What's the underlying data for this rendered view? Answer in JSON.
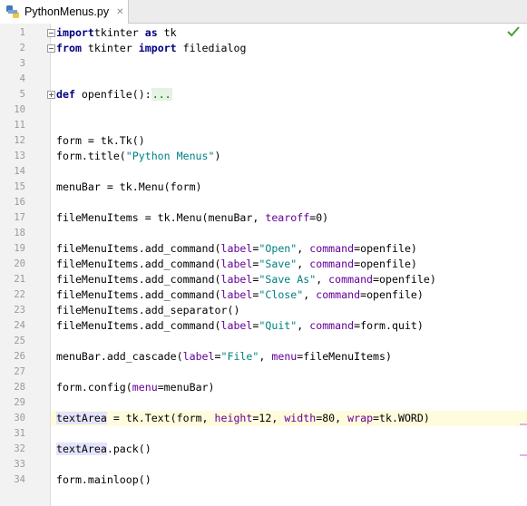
{
  "tab": {
    "title": "PythonMenus.py",
    "close": "✕"
  },
  "colors": {
    "keyword": "#000080",
    "string": "#008080",
    "kwarg": "#660099",
    "current_line": "#fffbdd"
  },
  "current_line": 30,
  "lines": [
    {
      "n": "1",
      "tokens": [
        [
          "kw",
          "import"
        ],
        [
          "",
          "tkinter "
        ],
        [
          "kw",
          "as"
        ],
        [
          "",
          " tk"
        ]
      ]
    },
    {
      "n": "2",
      "tokens": [
        [
          "kw",
          "from"
        ],
        [
          "",
          " tkinter "
        ],
        [
          "kw",
          "import"
        ],
        [
          "",
          " filedialog"
        ]
      ]
    },
    {
      "n": "3",
      "tokens": []
    },
    {
      "n": "4",
      "tokens": []
    },
    {
      "n": "5",
      "tokens": [
        [
          "kw",
          "def"
        ],
        [
          "",
          " openfile():"
        ],
        [
          "collapsed",
          "..."
        ]
      ]
    },
    {
      "n": "10",
      "tokens": []
    },
    {
      "n": "11",
      "tokens": []
    },
    {
      "n": "12",
      "tokens": [
        [
          "",
          "form = tk.Tk()"
        ]
      ]
    },
    {
      "n": "13",
      "tokens": [
        [
          "",
          "form.title("
        ],
        [
          "str",
          "\"Python Menus\""
        ],
        [
          "",
          ")"
        ]
      ]
    },
    {
      "n": "14",
      "tokens": []
    },
    {
      "n": "15",
      "tokens": [
        [
          "",
          "menuBar = tk.Menu(form)"
        ]
      ]
    },
    {
      "n": "16",
      "tokens": []
    },
    {
      "n": "17",
      "tokens": [
        [
          "",
          "fileMenuItems = tk.Menu(menuBar, "
        ],
        [
          "kwarg",
          "tearoff"
        ],
        [
          "",
          "=0)"
        ]
      ]
    },
    {
      "n": "18",
      "tokens": []
    },
    {
      "n": "19",
      "tokens": [
        [
          "",
          "fileMenuItems.add_command("
        ],
        [
          "kwarg",
          "label"
        ],
        [
          "",
          "="
        ],
        [
          "str",
          "\"Open\""
        ],
        [
          "",
          ", "
        ],
        [
          "kwarg",
          "command"
        ],
        [
          "",
          "=openfile)"
        ]
      ]
    },
    {
      "n": "20",
      "tokens": [
        [
          "",
          "fileMenuItems.add_command("
        ],
        [
          "kwarg",
          "label"
        ],
        [
          "",
          "="
        ],
        [
          "str",
          "\"Save\""
        ],
        [
          "",
          ", "
        ],
        [
          "kwarg",
          "command"
        ],
        [
          "",
          "=openfile)"
        ]
      ]
    },
    {
      "n": "21",
      "tokens": [
        [
          "",
          "fileMenuItems.add_command("
        ],
        [
          "kwarg",
          "label"
        ],
        [
          "",
          "="
        ],
        [
          "str",
          "\"Save As\""
        ],
        [
          "",
          ", "
        ],
        [
          "kwarg",
          "command"
        ],
        [
          "",
          "=openfile)"
        ]
      ]
    },
    {
      "n": "22",
      "tokens": [
        [
          "",
          "fileMenuItems.add_command("
        ],
        [
          "kwarg",
          "label"
        ],
        [
          "",
          "="
        ],
        [
          "str",
          "\"Close\""
        ],
        [
          "",
          ", "
        ],
        [
          "kwarg",
          "command"
        ],
        [
          "",
          "=openfile)"
        ]
      ]
    },
    {
      "n": "23",
      "tokens": [
        [
          "",
          "fileMenuItems.add_separator()"
        ]
      ]
    },
    {
      "n": "24",
      "tokens": [
        [
          "",
          "fileMenuItems.add_command("
        ],
        [
          "kwarg",
          "label"
        ],
        [
          "",
          "="
        ],
        [
          "str",
          "\"Quit\""
        ],
        [
          "",
          ", "
        ],
        [
          "kwarg",
          "command"
        ],
        [
          "",
          "=form.quit)"
        ]
      ]
    },
    {
      "n": "25",
      "tokens": []
    },
    {
      "n": "26",
      "tokens": [
        [
          "",
          "menuBar.add_cascade("
        ],
        [
          "kwarg",
          "label"
        ],
        [
          "",
          "="
        ],
        [
          "str",
          "\"File\""
        ],
        [
          "",
          ", "
        ],
        [
          "kwarg",
          "menu"
        ],
        [
          "",
          "=fileMenuItems)"
        ]
      ]
    },
    {
      "n": "27",
      "tokens": []
    },
    {
      "n": "28",
      "tokens": [
        [
          "",
          "form.config("
        ],
        [
          "kwarg",
          "menu"
        ],
        [
          "",
          "=menuBar)"
        ]
      ]
    },
    {
      "n": "29",
      "tokens": []
    },
    {
      "n": "30",
      "tokens": [
        [
          "ref-hl",
          "textArea"
        ],
        [
          "",
          " = tk.Text(form, "
        ],
        [
          "kwarg",
          "height"
        ],
        [
          "",
          "=12, "
        ],
        [
          "kwarg",
          "width"
        ],
        [
          "",
          "=80, "
        ],
        [
          "kwarg",
          "wrap"
        ],
        [
          "",
          "=tk.WORD)"
        ]
      ]
    },
    {
      "n": "31",
      "tokens": []
    },
    {
      "n": "32",
      "tokens": [
        [
          "ref-hl",
          "textArea"
        ],
        [
          "",
          ".pack()"
        ]
      ]
    },
    {
      "n": "33",
      "tokens": []
    },
    {
      "n": "34",
      "tokens": [
        [
          "",
          "form.mainloop()"
        ]
      ]
    }
  ]
}
